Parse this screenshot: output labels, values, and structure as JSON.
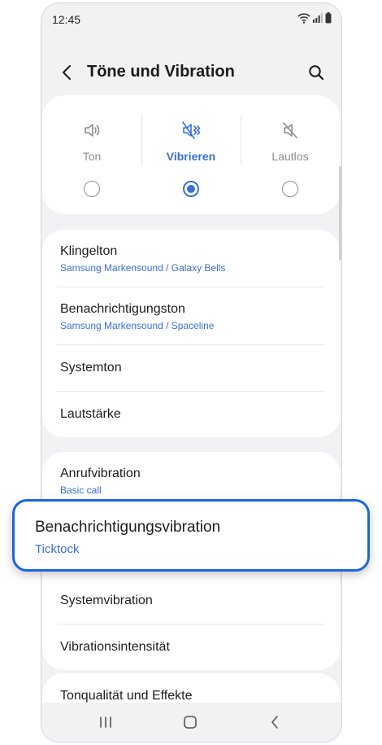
{
  "status_bar": {
    "time": "12:45"
  },
  "header": {
    "title": "Töne und Vibration"
  },
  "modes": [
    {
      "label": "Ton",
      "selected": false
    },
    {
      "label": "Vibrieren",
      "selected": true
    },
    {
      "label": "Lautlos",
      "selected": false
    }
  ],
  "sound_section": [
    {
      "title": "Klingelton",
      "subtitle": "Samsung Markensound / Galaxy Bells"
    },
    {
      "title": "Benachrichtigungston",
      "subtitle": "Samsung Markensound / Spaceline"
    },
    {
      "title": "Systemton"
    },
    {
      "title": "Lautstärke"
    }
  ],
  "vibration_section": [
    {
      "title": "Anrufvibration",
      "subtitle": "Basic call"
    },
    {
      "title": "Benachrichtigungsvibration",
      "subtitle": "Ticktock"
    },
    {
      "title": "Systemvibration"
    },
    {
      "title": "Vibrationsintensität"
    }
  ],
  "quality_section": [
    {
      "title": "Tonqualität und Effekte"
    }
  ],
  "colors": {
    "accent": "#3a6fd7",
    "highlight_border": "#1a66e0",
    "background": "#f2f2f4"
  }
}
